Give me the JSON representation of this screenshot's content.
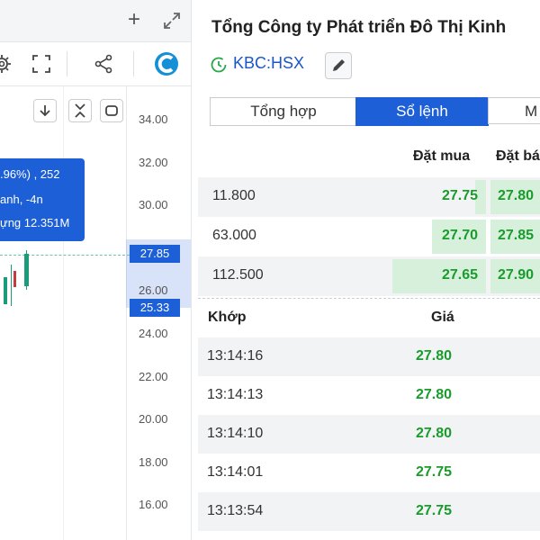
{
  "chart_panel": {
    "toolbar_icons": [
      "gear-icon",
      "fullscreen-icon",
      "share-icon",
      "logo-icon"
    ],
    "top_icons": [
      "plus-icon",
      "expand-icon"
    ],
    "axis_buttons": [
      "arrow-down-icon",
      "collapse-icon",
      "reset-icon"
    ],
    "y_ticks": [
      "34.00",
      "32.00",
      "30.00",
      "26.00",
      "24.00",
      "22.00",
      "20.00",
      "18.00",
      "16.00"
    ],
    "price_current": "27.85",
    "price_marker": "25.33",
    "tooltip": {
      "line1": ".96%) , 252",
      "line2": "anh, -4n",
      "line3": "ựng 12.351M"
    },
    "plus_label": "+"
  },
  "right_panel": {
    "company_name": "Tổng Công ty Phát triển Đô Thị Kinh",
    "ticker": "KBC:HSX",
    "tabs": [
      {
        "label": "Tổng hợp",
        "active": false
      },
      {
        "label": "Sổ lệnh",
        "active": true
      },
      {
        "label": "M",
        "active": false
      }
    ],
    "orderbook": {
      "header_buy": "Đặt mua",
      "header_sell": "Đặt bá",
      "rows": [
        {
          "volume": "11.800",
          "bid": "27.75",
          "ask": "27.80"
        },
        {
          "volume": "63.000",
          "bid": "27.70",
          "ask": "27.85"
        },
        {
          "volume": "112.500",
          "bid": "27.65",
          "ask": "27.90"
        }
      ]
    },
    "matched": {
      "header_time": "Khớp",
      "header_price": "Giá",
      "rows": [
        {
          "time": "13:14:16",
          "price": "27.80"
        },
        {
          "time": "13:14:13",
          "price": "27.80"
        },
        {
          "time": "13:14:10",
          "price": "27.80"
        },
        {
          "time": "13:14:01",
          "price": "27.75"
        },
        {
          "time": "13:13:54",
          "price": "27.75"
        }
      ]
    }
  },
  "colors": {
    "accent": "#1c5fd6",
    "up_green": "#1a9c2c",
    "bar_green": "#d7f0dc"
  }
}
